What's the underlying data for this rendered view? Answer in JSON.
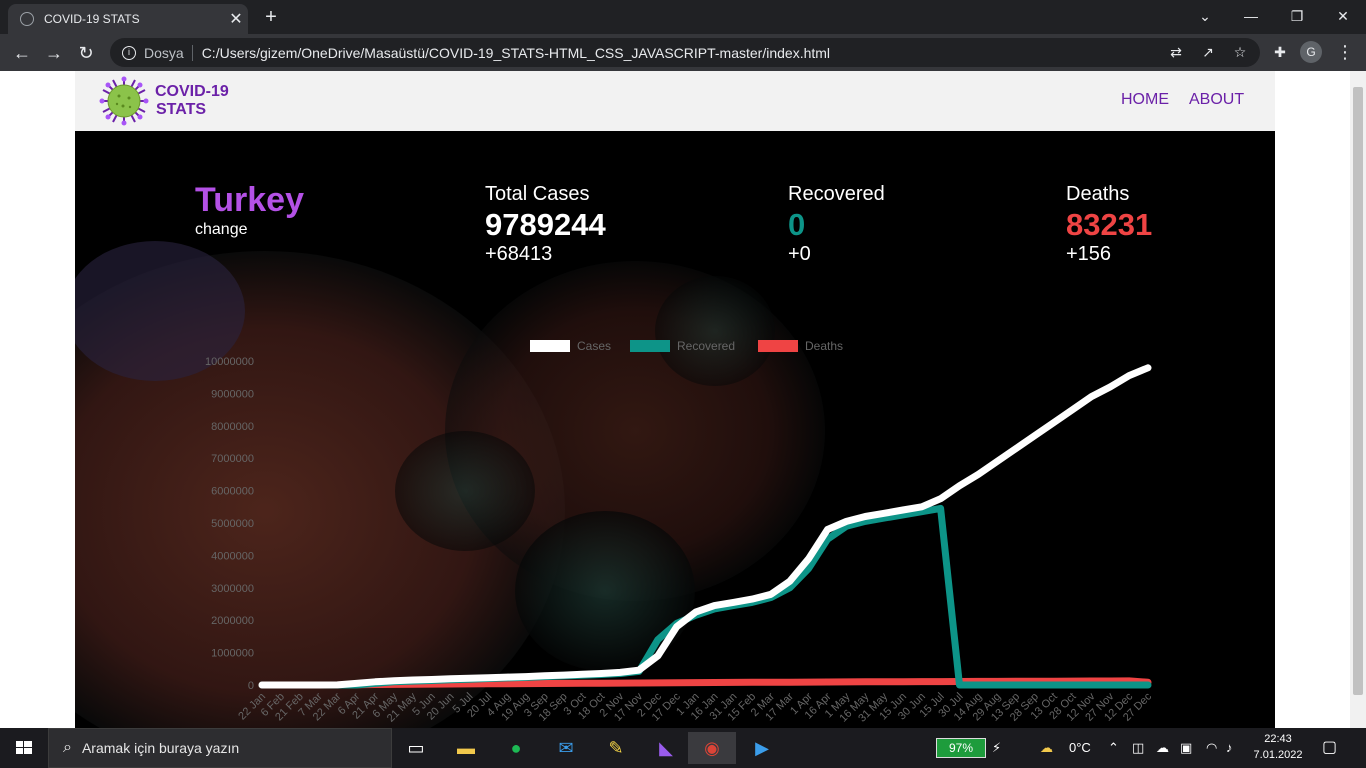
{
  "browser": {
    "tab_title": "COVID-19 STATS",
    "new_tab": "+",
    "omnibox_prefix": "Dosya",
    "url": "C:/Users/gizem/OneDrive/Masaüstü/COVID-19_STATS-HTML_CSS_JAVASCRIPT-master/index.html",
    "avatar_letter": "G"
  },
  "site": {
    "logo_line1": "COVID-19",
    "logo_line2": "STATS",
    "nav": [
      "HOME",
      "ABOUT"
    ],
    "country": "Turkey",
    "change_label": "change",
    "stats": [
      {
        "label": "Total Cases",
        "value": "9789244",
        "delta": "+68413",
        "color": "#ffffff"
      },
      {
        "label": "Recovered",
        "value": "0",
        "delta": "+0",
        "color": "#0d9488"
      },
      {
        "label": "Deaths",
        "value": "83231",
        "delta": "+156",
        "color": "#ef4444"
      }
    ]
  },
  "chart_data": {
    "type": "line",
    "legend": [
      "Cases",
      "Recovered",
      "Deaths"
    ],
    "legend_position": "top",
    "series_colors": [
      "#ffffff",
      "#0d9488",
      "#ef4444"
    ],
    "ylim": [
      0,
      10000000
    ],
    "y_ticks": [
      0,
      1000000,
      2000000,
      3000000,
      4000000,
      5000000,
      6000000,
      7000000,
      8000000,
      9000000,
      10000000
    ],
    "x_labels": [
      "22 Jan",
      "6 Feb",
      "21 Feb",
      "7 Mar",
      "22 Mar",
      "6 Apr",
      "21 Apr",
      "6 May",
      "21 May",
      "5 Jun",
      "20 Jun",
      "5 Jul",
      "20 Jul",
      "4 Aug",
      "19 Aug",
      "3 Sep",
      "18 Sep",
      "3 Oct",
      "18 Oct",
      "2 Nov",
      "17 Nov",
      "2 Dec",
      "17 Dec",
      "1 Jan",
      "16 Jan",
      "31 Jan",
      "15 Feb",
      "2 Mar",
      "17 Mar",
      "1 Apr",
      "16 Apr",
      "1 May",
      "16 May",
      "31 May",
      "15 Jun",
      "30 Jun",
      "15 Jul",
      "30 Jul",
      "14 Aug",
      "29 Aug",
      "13 Sep",
      "28 Sep",
      "13 Oct",
      "28 Oct",
      "12 Nov",
      "27 Nov",
      "12 Dec",
      "27 Dec"
    ],
    "series": [
      {
        "name": "Cases",
        "values": [
          0,
          0,
          0,
          0,
          2000,
          50000,
          100000,
          130000,
          155000,
          170000,
          190000,
          210000,
          225000,
          245000,
          260000,
          285000,
          305000,
          330000,
          355000,
          390000,
          460000,
          900000,
          1800000,
          2250000,
          2450000,
          2550000,
          2650000,
          2800000,
          3200000,
          3900000,
          4800000,
          5050000,
          5200000,
          5300000,
          5400000,
          5500000,
          5750000,
          6150000,
          6500000,
          6900000,
          7300000,
          7700000,
          8100000,
          8500000,
          8900000,
          9200000,
          9550000,
          9789244
        ]
      },
      {
        "name": "Recovered",
        "values": [
          0,
          0,
          0,
          0,
          0,
          0,
          50000,
          100000,
          120000,
          140000,
          160000,
          180000,
          200000,
          220000,
          235000,
          260000,
          280000,
          300000,
          325000,
          355000,
          420000,
          1400000,
          1900000,
          2150000,
          2350000,
          2450000,
          2550000,
          2700000,
          3000000,
          3600000,
          4500000,
          4900000,
          5050000,
          5150000,
          5250000,
          5350000,
          5450000,
          0,
          0,
          0,
          0,
          0,
          0,
          0,
          0,
          0,
          0,
          0
        ]
      },
      {
        "name": "Deaths",
        "values": [
          0,
          0,
          0,
          0,
          0,
          10000,
          15000,
          20000,
          25000,
          28000,
          31000,
          34000,
          37000,
          40000,
          43000,
          46000,
          49000,
          52000,
          55000,
          58000,
          62000,
          66000,
          70000,
          74000,
          77000,
          80000,
          82000,
          84000,
          86000,
          89000,
          92000,
          95000,
          98000,
          100000,
          102000,
          104000,
          106000,
          108000,
          110000,
          112000,
          114000,
          116000,
          118000,
          120000,
          122000,
          124000,
          126000,
          83231
        ]
      }
    ]
  }
}
